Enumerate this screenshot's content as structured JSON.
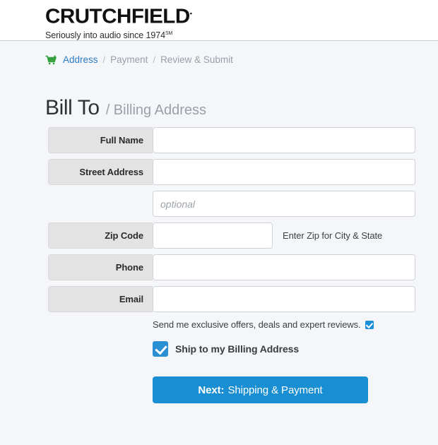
{
  "header": {
    "logo_wordmark": "CRUTCHFIELD",
    "logo_trademark": "▪",
    "tagline": "Seriously into audio since 1974",
    "tagline_sm": "SM"
  },
  "breadcrumb": {
    "cart_icon": "shopping-cart-icon",
    "separator": "/",
    "items": [
      {
        "label": "Address",
        "state": "active"
      },
      {
        "label": "Payment",
        "state": "muted"
      },
      {
        "label": "Review & Submit",
        "state": "muted"
      }
    ]
  },
  "page_title": {
    "main": "Bill To",
    "sub": "/ Billing Address"
  },
  "form": {
    "fields": [
      {
        "label": "Full Name",
        "value": "",
        "placeholder": ""
      },
      {
        "label": "Street Address",
        "value": "",
        "placeholder": ""
      },
      {
        "label": "",
        "value": "",
        "placeholder": "optional"
      },
      {
        "label": "Zip Code",
        "value": "",
        "placeholder": "",
        "hint": "Enter Zip for City & State"
      },
      {
        "label": "Phone",
        "value": "",
        "placeholder": ""
      },
      {
        "label": "Email",
        "value": "",
        "placeholder": ""
      }
    ],
    "optin": {
      "text": "Send me exclusive offers, deals and expert reviews.",
      "checked": true
    },
    "ship_same": {
      "label": "Ship to my Billing Address",
      "checked": true
    },
    "submit": {
      "strong": "Next:",
      "rest": "Shipping & Payment"
    }
  },
  "colors": {
    "accent_blue": "#1a8ed3",
    "link_blue": "#2b7cc4",
    "cart_green": "#33a13c",
    "label_gray": "#e3e3e3",
    "page_bg": "#f4f6fa"
  }
}
